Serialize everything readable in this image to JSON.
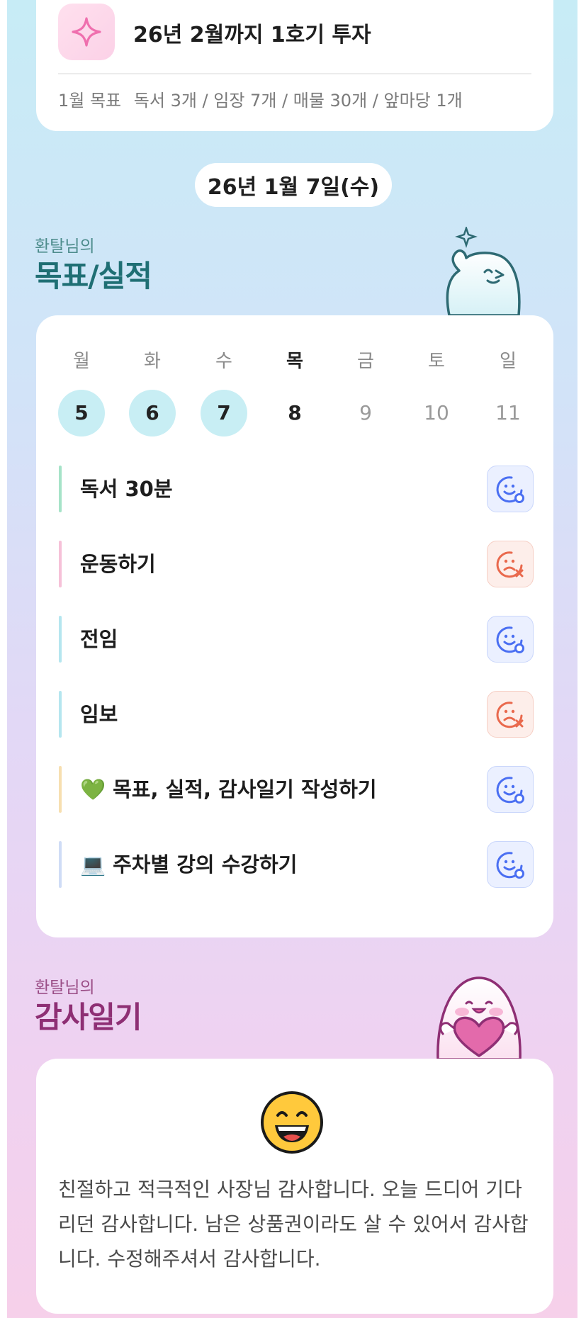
{
  "top_card": {
    "title": "26년 2월까지 1호기 투자",
    "goal_label": "1월 목표",
    "goal_text": "독서 3개 / 임장 7개 / 매물 30개 / 앞마당 1개"
  },
  "date_pill": "26년 1월 7일(수)",
  "goal_section": {
    "subtitle": "환탈님의",
    "title": "목표/실적"
  },
  "week": {
    "days": [
      "월",
      "화",
      "수",
      "목",
      "금",
      "토",
      "일"
    ],
    "dates": [
      "5",
      "6",
      "7",
      "8",
      "9",
      "10",
      "11"
    ],
    "today_index": 3,
    "done_indices": [
      0,
      1,
      2
    ]
  },
  "tasks": [
    {
      "emoji": "",
      "label": "독서 30분",
      "status": "success",
      "bar_color": "#a6e3c8"
    },
    {
      "emoji": "",
      "label": "운동하기",
      "status": "fail",
      "bar_color": "#f6c1d8"
    },
    {
      "emoji": "",
      "label": "전임",
      "status": "success",
      "bar_color": "#b5e6ef"
    },
    {
      "emoji": "",
      "label": "임보",
      "status": "fail",
      "bar_color": "#b5e6ef"
    },
    {
      "emoji": "💚",
      "label": "목표, 실적, 감사일기 작성하기",
      "status": "success",
      "bar_color": "#f7dfb0"
    },
    {
      "emoji": "💻",
      "label": "주차별 강의 수강하기",
      "status": "success",
      "bar_color": "#cfdcf6"
    }
  ],
  "thanks_section": {
    "subtitle": "환탈님의",
    "title": "감사일기"
  },
  "thanks": {
    "text": "친절하고 적극적인 사장님 감사합니다. 오늘 드디어 기다리던 감사합니다. 남은 상품권이라도 살 수 있어서 감사합니다. 수정해주셔서 감사합니다."
  },
  "icons": {
    "sparkle": "sparkle-icon",
    "success": "smile-check-icon",
    "fail": "sad-x-icon",
    "thanks": "grinning-face-icon"
  },
  "colors": {
    "success": "#4a6ff2",
    "fail": "#e9694d",
    "done_date": "#c8eef4",
    "goal_title": "#1f6f74",
    "thanks_title": "#8e2f74"
  }
}
